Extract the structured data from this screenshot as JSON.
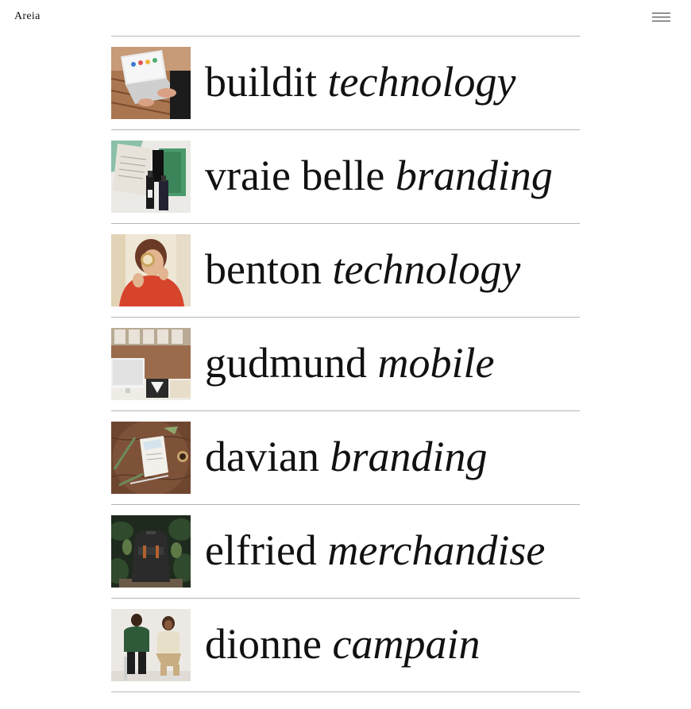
{
  "site": {
    "logo": "Areia",
    "menu_icon": "hamburger-menu-icon"
  },
  "projects": [
    {
      "name": "buildit",
      "category": "technology",
      "thumb": "laptop-on-desk-photo"
    },
    {
      "name": "vraie belle",
      "category": "branding",
      "thumb": "cosmetic-bottles-box-photo"
    },
    {
      "name": "benton",
      "category": "technology",
      "thumb": "woman-with-magnifier-photo"
    },
    {
      "name": "gudmund",
      "category": "mobile",
      "thumb": "office-desk-computer-photo"
    },
    {
      "name": "davian",
      "category": "branding",
      "thumb": "business-card-table-photo"
    },
    {
      "name": "elfried",
      "category": "merchandise",
      "thumb": "backpack-in-forest-photo"
    },
    {
      "name": "dionne",
      "category": "campain",
      "thumb": "two-people-seated-photo"
    }
  ]
}
